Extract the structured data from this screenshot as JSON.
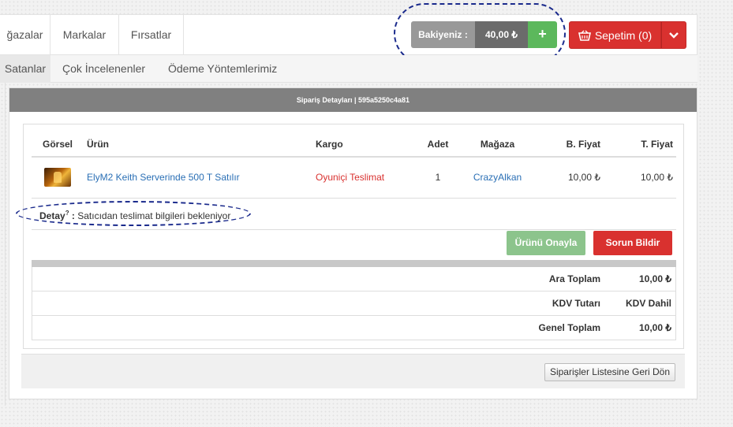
{
  "nav": {
    "items": [
      "ğazalar",
      "Markalar",
      "Fırsatlar"
    ],
    "balance_label": "Bakiyeniz :",
    "balance_value": "40,00 ₺",
    "add_label": "+",
    "cart_label": "Sepetim (0)"
  },
  "subnav": {
    "items": [
      "Satanlar",
      "Çok İncelenenler",
      "Ödeme Yöntemlerimiz"
    ]
  },
  "panel": {
    "title": "Sipariş Detayları | 595a5250c4a81"
  },
  "table": {
    "headers": [
      "Görsel",
      "Ürün",
      "Kargo",
      "Adet",
      "Mağaza",
      "B. Fiyat",
      "T. Fiyat"
    ],
    "row": {
      "product": "ElyM2 Keith Serverinde 500 T Satılır",
      "cargo": "Oyuniçi Teslimat",
      "qty": "1",
      "store": "CrazyAlkan",
      "unit_price": "10,00 ₺",
      "total_price": "10,00 ₺"
    }
  },
  "detail": {
    "label": "Detay",
    "sup": "?",
    "sep": " : ",
    "text": "Satıcıdan teslimat bilgileri bekleniyor"
  },
  "actions": {
    "approve": "Ürünü Onayla",
    "report": "Sorun Bildir"
  },
  "totals": [
    {
      "label": "Ara Toplam",
      "value": "10,00 ₺"
    },
    {
      "label": "KDV Tutarı",
      "value": "KDV Dahil"
    },
    {
      "label": "Genel Toplam",
      "value": "10,00 ₺"
    }
  ],
  "footer": {
    "back_label": "Siparişler Listesine Geri Dön"
  },
  "colors": {
    "brand_red": "#d9312f",
    "success_green": "#5cb85c",
    "link_blue": "#2a6fb5",
    "annotation_navy": "#1a2a8c"
  }
}
